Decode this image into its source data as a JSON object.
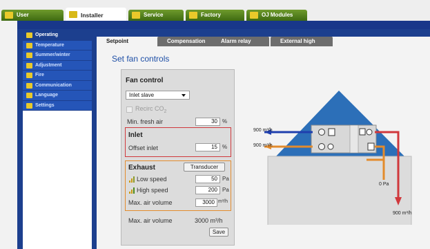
{
  "top_tabs": [
    {
      "label": "User",
      "active": false
    },
    {
      "label": "Installer",
      "active": true
    },
    {
      "label": "Service",
      "active": false
    },
    {
      "label": "Factory",
      "active": false
    },
    {
      "label": "OJ Modules",
      "active": false
    }
  ],
  "sidebar": {
    "items": [
      {
        "label": "Operating",
        "active": true
      },
      {
        "label": "Temperature"
      },
      {
        "label": "Summer/winter"
      },
      {
        "label": "Adjustment"
      },
      {
        "label": "Fire"
      },
      {
        "label": "Communication"
      },
      {
        "label": "Language"
      },
      {
        "label": "Settings"
      }
    ]
  },
  "sub_tabs": [
    {
      "label": "Setpoint",
      "active": true
    },
    {
      "label": "Compensation"
    },
    {
      "label": "Alarm relay"
    },
    {
      "label": "External high"
    }
  ],
  "page": {
    "title": "Set fan controls"
  },
  "fan_control": {
    "heading": "Fan control",
    "mode_select": "Inlet slave",
    "recirc_label": "Recirc CO",
    "recirc_sub": "2",
    "min_fresh_air_label": "Min. fresh air",
    "min_fresh_air_value": "30",
    "min_fresh_air_unit": "%",
    "inlet": {
      "heading": "Inlet",
      "offset_label": "Offset inlet",
      "offset_value": "15",
      "offset_unit": "%"
    },
    "exhaust": {
      "heading": "Exhaust",
      "transducer_button": "Transducer",
      "low_speed_label": "Low speed",
      "low_speed_value": "50",
      "low_speed_unit": "Pa",
      "high_speed_label": "High speed",
      "high_speed_value": "200",
      "high_speed_unit": "Pa",
      "max_air_volume_label": "Max. air volume",
      "max_air_volume_value": "3000",
      "max_air_volume_unit": "m³/h"
    },
    "readout_label": "Max. air volume",
    "readout_value": "3000 m³/h",
    "save_button": "Save"
  },
  "diagram": {
    "inlet_flow": "900 m³/h",
    "exhaust_flow": "900 m³/h",
    "pressure": "0 Pa",
    "outlet_flow": "900 m³/h"
  },
  "colors": {
    "frame_blue": "#1c3f8e",
    "tab_green": "#4f7d1c",
    "accent_text": "#1e4fa6",
    "inlet_red": "#d0383c",
    "exhaust_orange": "#e38b2c"
  }
}
